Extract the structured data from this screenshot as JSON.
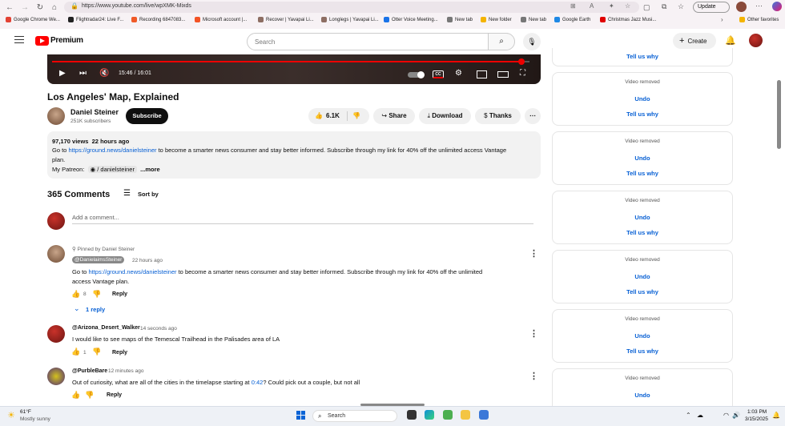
{
  "browser": {
    "url": "https://www.youtube.com/live/wpXMK-Mixds",
    "update_label": "Update",
    "bookmarks": [
      {
        "label": "Google Chrome We...",
        "color": "#e34133"
      },
      {
        "label": "Flightradar24: Live F...",
        "color": "#222222"
      },
      {
        "label": "Recording 6847083...",
        "color": "#f05a28"
      },
      {
        "label": "Microsoft account |...",
        "color": "#f35325"
      },
      {
        "label": "Recover | Yavapai Li...",
        "color": "#8d6e63"
      },
      {
        "label": "Longlegs | Yavapai Li...",
        "color": "#8d6e63"
      },
      {
        "label": "Otter Voice Meeting...",
        "color": "#1a73e8"
      },
      {
        "label": "New tab",
        "color": "#777777"
      },
      {
        "label": "New folder",
        "color": "#f4b400"
      },
      {
        "label": "New tab",
        "color": "#777777"
      },
      {
        "label": "Google Earth",
        "color": "#1e88e5"
      },
      {
        "label": "Christmas Jazz Musi...",
        "color": "#e00000"
      }
    ],
    "other_favorites": "Other favorites"
  },
  "yt_header": {
    "logo": "Premium",
    "search_placeholder": "Search",
    "create_label": "Create"
  },
  "player": {
    "time": "15:46 / 16:01",
    "progress": 0.984
  },
  "video": {
    "title": "Los Angeles' Map, Explained",
    "channel": "Daniel Steiner",
    "subscribers": "251K subscribers",
    "subscribe_label": "Subscribe",
    "likes": "6.1K",
    "share_label": "Share",
    "download_label": "Download",
    "thanks_label": "Thanks"
  },
  "description": {
    "views": "97,170 views",
    "age": "22 hours ago",
    "line1_pre": "Go to ",
    "line1_link": "https://ground.news/danielsteiner",
    "line1_post": " to become a smarter news consumer and stay better informed. Subscribe through my link for 40% off the unlimited access Vantage",
    "line2": "plan.",
    "patreon_label": "My Patreon:",
    "patreon_handle": "/ danielsteiner",
    "more": "...more"
  },
  "comments": {
    "count": "365 Comments",
    "sort_label": "Sort by",
    "add_placeholder": "Add a comment...",
    "pinned": {
      "pinned_by": "Pinned by Daniel Steiner",
      "author": "@DanielaimsSteiner",
      "age": "22 hours ago",
      "text_pre": "Go to ",
      "text_link": "https://ground.news/danielsteiner",
      "text_post": " to become a smarter news consumer and stay better informed. Subscribe through my link for 40% off the unlimited",
      "text_line2": "access Vantage plan.",
      "likes": "8",
      "reply_label": "Reply",
      "replies": "1 reply"
    },
    "items": [
      {
        "author": "@Arizona_Desert_Walker",
        "age": "14 seconds ago",
        "text_pre": "I would like to see maps of the Temescal Trailhead in the Palisades area of LA",
        "text_link": "",
        "text_post": "",
        "likes": "1",
        "reply_label": "Reply"
      },
      {
        "author": "@PurbleBare",
        "age": "12 minutes ago",
        "text_pre": "Out of curiosity, what are all of the cities in the timelapse starting at ",
        "text_link": "0:42",
        "text_post": "? Could pick out a couple, but not all",
        "likes": "",
        "reply_label": "Reply"
      }
    ]
  },
  "side_panel": {
    "top_link": "Tell us why",
    "cards": [
      {
        "removed": "Video removed",
        "undo": "Undo",
        "why": "Tell us why"
      },
      {
        "removed": "Video removed",
        "undo": "Undo",
        "why": "Tell us why"
      },
      {
        "removed": "Video removed",
        "undo": "Undo",
        "why": "Tell us why"
      },
      {
        "removed": "Video removed",
        "undo": "Undo",
        "why": "Tell us why"
      },
      {
        "removed": "Video removed",
        "undo": "Undo",
        "why": "Tell us why"
      },
      {
        "removed": "Video removed",
        "undo": "Undo",
        "why": ""
      }
    ]
  },
  "taskbar": {
    "weather_temp": "61°F",
    "weather_text": "Mostly sunny",
    "search_label": "Search",
    "time": "1:03 PM",
    "date": "3/15/2025"
  }
}
